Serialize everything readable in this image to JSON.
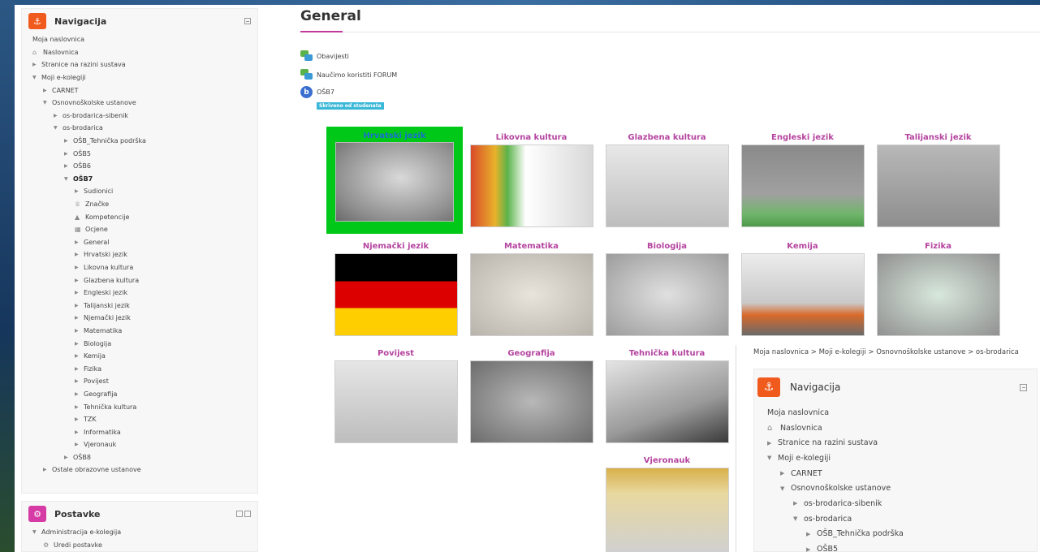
{
  "nav": {
    "title": "Navigacija",
    "items": [
      {
        "label": "Moja naslovnica",
        "indent": 0,
        "marker": "none"
      },
      {
        "label": "Naslovnica",
        "indent": 0,
        "marker": "home"
      },
      {
        "label": "Stranice na razini sustava",
        "indent": 0,
        "marker": "closed"
      },
      {
        "label": "Moji e-kolegiji",
        "indent": 0,
        "marker": "open"
      },
      {
        "label": "CARNET",
        "indent": 1,
        "marker": "closed"
      },
      {
        "label": "Osnovnoškolske ustanove",
        "indent": 1,
        "marker": "open"
      },
      {
        "label": "os-brodarica-sibenik",
        "indent": 2,
        "marker": "closed"
      },
      {
        "label": "os-brodarica",
        "indent": 2,
        "marker": "open"
      },
      {
        "label": "OŠB_Tehnička podrška",
        "indent": 3,
        "marker": "closed"
      },
      {
        "label": "OŠB5",
        "indent": 3,
        "marker": "closed"
      },
      {
        "label": "OŠB6",
        "indent": 3,
        "marker": "closed"
      },
      {
        "label": "OŠB7",
        "indent": 3,
        "marker": "open",
        "bold": true
      },
      {
        "label": "Sudionici",
        "indent": 4,
        "marker": "closed"
      },
      {
        "label": "Značke",
        "indent": 4,
        "marker": "trophy"
      },
      {
        "label": "Kompetencije",
        "indent": 4,
        "marker": "competency"
      },
      {
        "label": "Ocjene",
        "indent": 4,
        "marker": "grades"
      },
      {
        "label": "General",
        "indent": 4,
        "marker": "closed"
      },
      {
        "label": "Hrvatski jezik",
        "indent": 4,
        "marker": "closed"
      },
      {
        "label": "Likovna kultura",
        "indent": 4,
        "marker": "closed"
      },
      {
        "label": "Glazbena kultura",
        "indent": 4,
        "marker": "closed"
      },
      {
        "label": "Engleski jezik",
        "indent": 4,
        "marker": "closed"
      },
      {
        "label": "Talijanski jezik",
        "indent": 4,
        "marker": "closed"
      },
      {
        "label": "Njemački jezik",
        "indent": 4,
        "marker": "closed"
      },
      {
        "label": "Matematika",
        "indent": 4,
        "marker": "closed"
      },
      {
        "label": "Biologija",
        "indent": 4,
        "marker": "closed"
      },
      {
        "label": "Kemija",
        "indent": 4,
        "marker": "closed"
      },
      {
        "label": "Fizika",
        "indent": 4,
        "marker": "closed"
      },
      {
        "label": "Povijest",
        "indent": 4,
        "marker": "closed"
      },
      {
        "label": "Geografija",
        "indent": 4,
        "marker": "closed"
      },
      {
        "label": "Tehnička kultura",
        "indent": 4,
        "marker": "closed"
      },
      {
        "label": "TZK",
        "indent": 4,
        "marker": "closed"
      },
      {
        "label": "Informatika",
        "indent": 4,
        "marker": "closed"
      },
      {
        "label": "Vjeronauk",
        "indent": 4,
        "marker": "closed"
      },
      {
        "label": "OŠB8",
        "indent": 3,
        "marker": "closed"
      },
      {
        "label": "Ostale obrazovne ustanove",
        "indent": 1,
        "marker": "closed"
      }
    ]
  },
  "settings": {
    "title": "Postavke",
    "items": [
      {
        "label": "Administracija e-kolegija",
        "indent": 0,
        "marker": "open"
      },
      {
        "label": "Uredi postavke",
        "indent": 1,
        "marker": "gear"
      }
    ]
  },
  "main": {
    "title": "General",
    "activities": [
      {
        "label": "Obavijesti",
        "icon": "forum-icon"
      },
      {
        "label": "Naučimo koristiti FORUM",
        "icon": "forum-icon"
      },
      {
        "label": "OŠB7",
        "icon": "book-icon"
      }
    ],
    "hidden_badge": "Skriveno od studenata",
    "tiles": [
      {
        "label": "Hrvatski jezik",
        "picture": "p-book",
        "selected": true
      },
      {
        "label": "Likovna kultura",
        "picture": "p-art"
      },
      {
        "label": "Glazbena kultura",
        "picture": "p-music"
      },
      {
        "label": "Engleski jezik",
        "picture": "p-english"
      },
      {
        "label": "Talijanski jezik",
        "picture": "p-italian"
      },
      {
        "label": "Njemački jezik",
        "picture": "p-german"
      },
      {
        "label": "Matematika",
        "picture": "p-math"
      },
      {
        "label": "Biologija",
        "picture": "p-bio"
      },
      {
        "label": "Kemija",
        "picture": "p-chem"
      },
      {
        "label": "Fizika",
        "picture": "p-phys"
      },
      {
        "label": "Povijest",
        "picture": "p-hist"
      },
      {
        "label": "Geografija",
        "picture": "p-geo"
      },
      {
        "label": "Tehnička kultura",
        "picture": "p-tech"
      },
      {
        "label": "Vjeronauk",
        "picture": "p-rel"
      }
    ]
  },
  "breadcrumb": "Moja naslovnica > Moji e-kolegiji > Osnovnoškolske ustanove > os-brodarica",
  "nested_nav": {
    "title": "Navigacija",
    "items": [
      {
        "label": "Moja naslovnica",
        "indent": 0,
        "marker": "none"
      },
      {
        "label": "Naslovnica",
        "indent": 0,
        "marker": "home"
      },
      {
        "label": "Stranice na razini sustava",
        "indent": 0,
        "marker": "closed"
      },
      {
        "label": "Moji e-kolegiji",
        "indent": 0,
        "marker": "open"
      },
      {
        "label": "CARNET",
        "indent": 1,
        "marker": "closed"
      },
      {
        "label": "Osnovnoškolske ustanove",
        "indent": 1,
        "marker": "open"
      },
      {
        "label": "os-brodarica-sibenik",
        "indent": 2,
        "marker": "closed"
      },
      {
        "label": "os-brodarica",
        "indent": 2,
        "marker": "open"
      },
      {
        "label": "OŠB_Tehnička podrška",
        "indent": 3,
        "marker": "closed"
      },
      {
        "label": "OŠB5",
        "indent": 3,
        "marker": "closed"
      }
    ]
  },
  "colors": {
    "accent": "#b5449f",
    "selected_border": "#00c818",
    "badge": "#3bb8d8",
    "block_icon": "#f05a1c"
  }
}
